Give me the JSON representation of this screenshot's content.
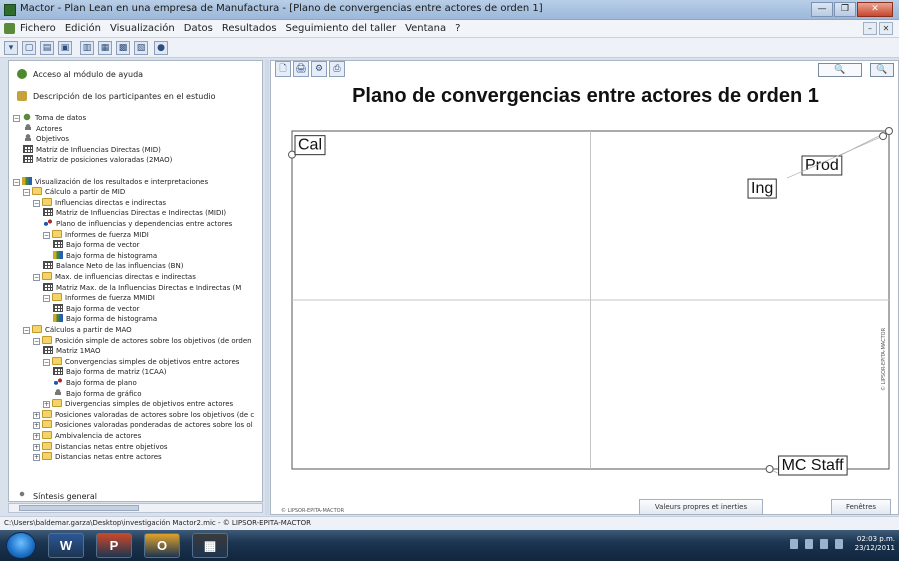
{
  "window": {
    "title": "Mactor  -  Plan Lean en una empresa de Manufactura - [Plano de convergencias entre actores de orden 1]",
    "buttons": [
      "—",
      "❐",
      "✕"
    ]
  },
  "menu": {
    "items": [
      "Fichero",
      "Edición",
      "Visualización",
      "Datos",
      "Resultados",
      "Seguimiento del taller",
      "Ventana",
      "?"
    ],
    "mdi_buttons": [
      "–",
      "✕"
    ]
  },
  "left_panel": {
    "top_items": [
      {
        "label": "Acceso al módulo de ayuda",
        "icon": "help-icon"
      },
      {
        "label": "Descripción de los participantes en el estudio",
        "icon": "participants-icon"
      }
    ],
    "tree": [
      {
        "level": 0,
        "exp": "−",
        "icon": "gear",
        "label": "Toma de datos"
      },
      {
        "level": 1,
        "exp": "",
        "icon": "actor",
        "label": "Actores"
      },
      {
        "level": 1,
        "exp": "",
        "icon": "actor",
        "label": "Objetivos"
      },
      {
        "level": 1,
        "exp": "",
        "icon": "table",
        "label": "Matriz de Influencias Directas (MID)"
      },
      {
        "level": 1,
        "exp": "",
        "icon": "table",
        "label": "Matriz de posiciones valoradas (2MAO)"
      },
      {
        "level": 0,
        "exp": "",
        "icon": "",
        "label": ""
      },
      {
        "level": 0,
        "exp": "−",
        "icon": "chart",
        "label": "Visualización de los resultados e interpretaciones"
      },
      {
        "level": 1,
        "exp": "−",
        "icon": "folder",
        "label": "Cálculo a partir de MID"
      },
      {
        "level": 2,
        "exp": "−",
        "icon": "folder",
        "label": "Influencias directas e indirectas"
      },
      {
        "level": 3,
        "exp": "",
        "icon": "table",
        "label": "Matriz de Influencias Directas e Indirectas (MIDI)"
      },
      {
        "level": 3,
        "exp": "",
        "icon": "plane",
        "label": "Plano de influencias y dependencias entre actores"
      },
      {
        "level": 3,
        "exp": "−",
        "icon": "folder",
        "label": "Informes de fuerza MIDI"
      },
      {
        "level": 4,
        "exp": "",
        "icon": "table",
        "label": "Bajo forma de vector"
      },
      {
        "level": 4,
        "exp": "",
        "icon": "chart",
        "label": "Bajo forma de histograma"
      },
      {
        "level": 3,
        "exp": "",
        "icon": "table",
        "label": "Balance Neto de las influencias (BN)"
      },
      {
        "level": 2,
        "exp": "−",
        "icon": "folder",
        "label": "Max. de influencias directas e indirectas"
      },
      {
        "level": 3,
        "exp": "",
        "icon": "table",
        "label": "Matriz Max. de la Influencias Directas e Indirectas (M"
      },
      {
        "level": 3,
        "exp": "−",
        "icon": "folder",
        "label": "Informes de fuerza MMIDI"
      },
      {
        "level": 4,
        "exp": "",
        "icon": "table",
        "label": "Bajo forma de vector"
      },
      {
        "level": 4,
        "exp": "",
        "icon": "chart",
        "label": "Bajo forma de histograma"
      },
      {
        "level": 1,
        "exp": "−",
        "icon": "folder",
        "label": "Cálculos a partir de MAO"
      },
      {
        "level": 2,
        "exp": "−",
        "icon": "folder",
        "label": "Posición simple de actores sobre los objetivos (de orden"
      },
      {
        "level": 3,
        "exp": "",
        "icon": "table",
        "label": "Matriz 1MAO"
      },
      {
        "level": 3,
        "exp": "−",
        "icon": "folder",
        "label": "Convergencias simples de objetivos entre actores"
      },
      {
        "level": 4,
        "exp": "",
        "icon": "table",
        "label": "Bajo forma de matriz (1CAA)"
      },
      {
        "level": 4,
        "exp": "",
        "icon": "plane",
        "label": "Bajo forma de plano"
      },
      {
        "level": 4,
        "exp": "",
        "icon": "actor",
        "label": "Bajo forma de gráfico"
      },
      {
        "level": 3,
        "exp": "+",
        "icon": "folder",
        "label": "Divergencias simples de objetivos entre actores"
      },
      {
        "level": 2,
        "exp": "+",
        "icon": "folder",
        "label": "Posiciones valoradas de actores sobre los objetivos (de c"
      },
      {
        "level": 2,
        "exp": "+",
        "icon": "folder",
        "label": "Posiciones valoradas ponderadas de actores sobre los ol"
      },
      {
        "level": 2,
        "exp": "+",
        "icon": "folder",
        "label": "Ambivalencia de actores"
      },
      {
        "level": 2,
        "exp": "+",
        "icon": "folder",
        "label": "Distancias netas entre objetivos"
      },
      {
        "level": 2,
        "exp": "+",
        "icon": "folder",
        "label": "Distancias netas entre actores"
      }
    ],
    "bottom_item": {
      "label": "Síntesis general",
      "icon": "synthesis-icon"
    }
  },
  "chart_toolbar": {
    "buttons": [
      "🗋",
      "🖨",
      "⚙",
      "⎙"
    ],
    "zoom_in": "🔍",
    "zoom_out": "🔍"
  },
  "chart_data": {
    "type": "scatter",
    "title": "Plano de convergencias entre actores de orden 1",
    "xlabel": "",
    "ylabel": "",
    "grid": "quadrants",
    "points": [
      {
        "label": "Cal",
        "x": 0.0,
        "y": 0.93
      },
      {
        "label": "Prod",
        "x": 1.0,
        "y": 1.0
      },
      {
        "label": "Ing",
        "x": 0.99,
        "y": 0.985
      },
      {
        "label": "MC Staff",
        "x": 0.8,
        "y": 0.0
      }
    ]
  },
  "chart_footer": {
    "credit_left": "© LIPSOR-EPITA-MACTOR",
    "credit_side": "© LIPSOR-EPITA-MACTOR",
    "btn_valeurs": "Valeurs propres et inerties",
    "btn_fenetres": "Fenêtres"
  },
  "status": {
    "path": "C:\\Users\\baldemar.garza\\Desktop\\investigación Mactor2.mic - © LIPSOR-EPITA-MACTOR"
  },
  "taskbar": {
    "apps": [
      {
        "name": "word",
        "glyph": "W"
      },
      {
        "name": "powerpoint",
        "glyph": "P"
      },
      {
        "name": "outlook",
        "glyph": "O"
      },
      {
        "name": "mactor",
        "glyph": "▦"
      }
    ],
    "clock_time": "02:03 p.m.",
    "clock_date": "23/12/2011",
    "colors": {
      "word": "#2b5797",
      "powerpoint": "#c8482b",
      "outlook": "#e0a22a",
      "mactor": "#3a3a3a"
    }
  }
}
